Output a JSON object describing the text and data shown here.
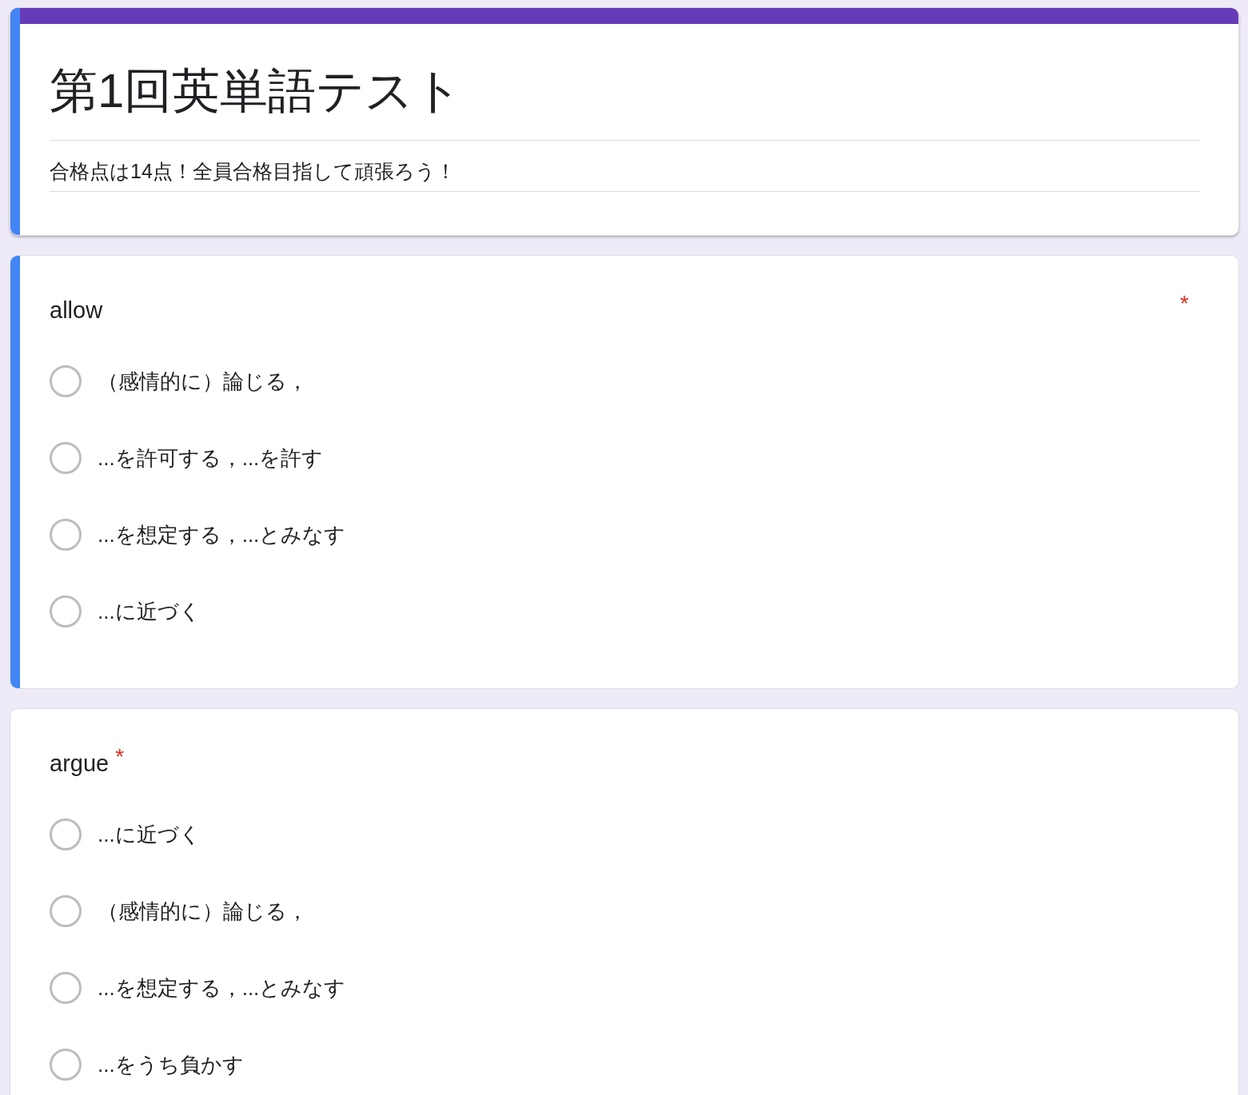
{
  "header": {
    "title": "第1回英単語テスト",
    "description": "合格点は14点！全員合格目指して頑張ろう！",
    "focused": true
  },
  "questions": [
    {
      "title": "allow",
      "required": true,
      "required_mark": "*",
      "asterisk_at_right": true,
      "focused": true,
      "options": [
        {
          "label": "（感情的に）論じる，",
          "selected": false
        },
        {
          "label": "...を許可する，...を許す",
          "selected": false
        },
        {
          "label": "...を想定する，...とみなす",
          "selected": false
        },
        {
          "label": "...に近づく",
          "selected": false
        }
      ]
    },
    {
      "title": "argue",
      "required": true,
      "required_mark": "*",
      "asterisk_at_right": false,
      "focused": false,
      "options": [
        {
          "label": "...に近づく",
          "selected": false
        },
        {
          "label": "（感情的に）論じる，",
          "selected": false
        },
        {
          "label": "...を想定する，...とみなす",
          "selected": false
        },
        {
          "label": "...をうち負かす",
          "selected": false
        }
      ]
    }
  ]
}
